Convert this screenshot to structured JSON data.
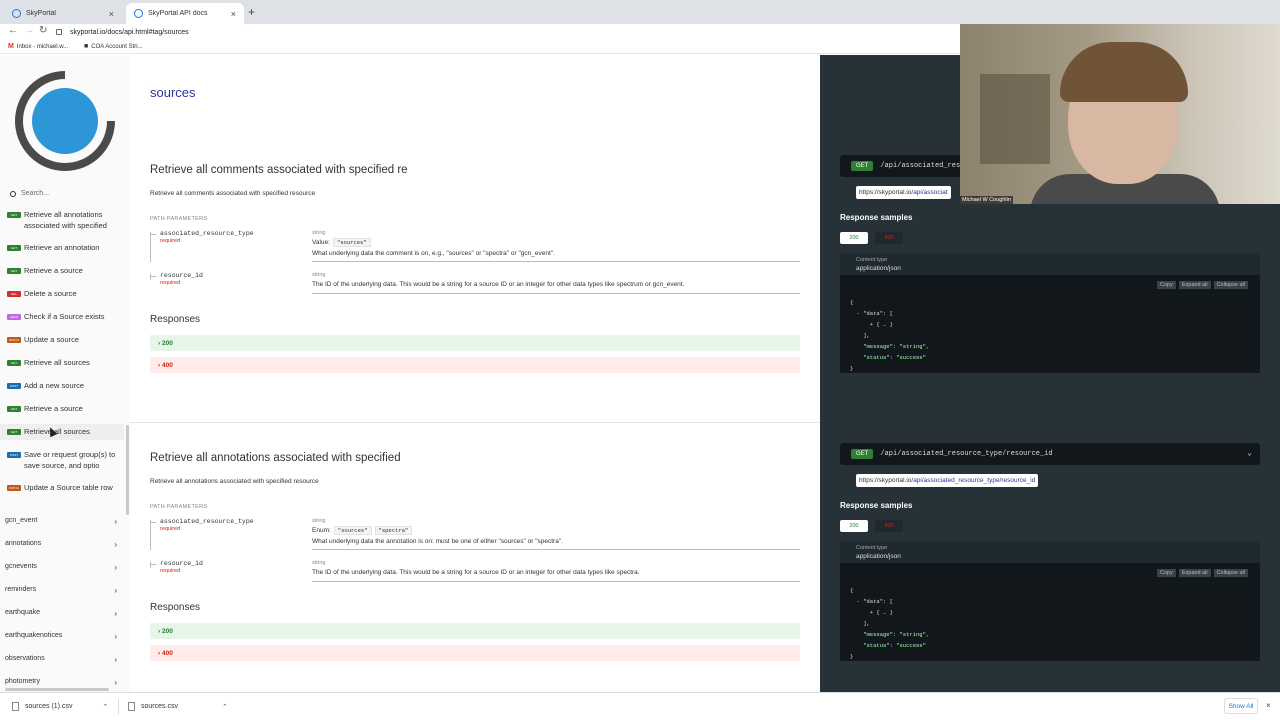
{
  "browser": {
    "tabs": [
      {
        "title": "SkyPortal",
        "close": "×"
      },
      {
        "title": "SkyPortal API docs",
        "close": "×"
      }
    ],
    "new_tab": "+",
    "url": "skyportal.io/docs/api.html#tag/sources",
    "bookmarks": [
      {
        "icon": "M",
        "label": "Inbox - michael.w..."
      },
      {
        "icon": "■",
        "label": "COA Account Stri..."
      }
    ]
  },
  "sidebar": {
    "search_placeholder": "Search...",
    "operations": [
      {
        "method": "GET",
        "label": "Retrieve all annotations associated with specified"
      },
      {
        "method": "GET",
        "label": "Retrieve an annotation"
      },
      {
        "method": "GET",
        "label": "Retrieve a source"
      },
      {
        "method": "DEL",
        "label": "Delete a source"
      },
      {
        "method": "HEAD",
        "label": "Check if a Source exists"
      },
      {
        "method": "PATCH",
        "label": "Update a source"
      },
      {
        "method": "GET",
        "label": "Retrieve all sources"
      },
      {
        "method": "POST",
        "label": "Add a new source"
      },
      {
        "method": "GET",
        "label": "Retrieve a source"
      },
      {
        "method": "GET",
        "label": "Retrieve all sources"
      },
      {
        "method": "POST",
        "label": "Save or request group(s) to save source, and optio"
      },
      {
        "method": "PATCH",
        "label": "Update a Source table row"
      }
    ],
    "categories": [
      "gcn_event",
      "annotations",
      "gcnevents",
      "reminders",
      "earthquake",
      "earthquakenotices",
      "observations",
      "photometry"
    ]
  },
  "main": {
    "section_title": "sources",
    "operations": [
      {
        "title": "Retrieve all comments associated with specified re",
        "description": "Retrieve all comments associated with specified resource",
        "path_params_label": "PATH PARAMETERS",
        "params": [
          {
            "name": "associated_resource_type",
            "required": "required",
            "type": "string",
            "value_label": "Value:",
            "values": [
              "\"sources\""
            ],
            "description": "What underlying data the comment is on, e.g., \"sources\" or \"spectra\" or \"gcn_event\"."
          },
          {
            "name": "resource_id",
            "required": "required",
            "type": "string",
            "value_label": "",
            "values": [],
            "description": "The ID of the underlying data. This would be a string for a source ID or an integer for other data types like spectrum or gcn_event."
          }
        ],
        "responses_title": "Responses",
        "responses": [
          "200",
          "400"
        ]
      },
      {
        "title": "Retrieve all annotations associated with specified",
        "description": "Retrieve all annotations associated with specified resource",
        "path_params_label": "PATH PARAMETERS",
        "params": [
          {
            "name": "associated_resource_type",
            "required": "required",
            "type": "string",
            "value_label": "Enum:",
            "values": [
              "\"sources\"",
              "\"spectra\""
            ],
            "description": "What underlying data the annotation is on: must be one of either \"sources\" or \"spectra\"."
          },
          {
            "name": "resource_id",
            "required": "required",
            "type": "string",
            "value_label": "",
            "values": [],
            "description": "The ID of the underlying data. This would be a string for a source ID or an integer for other data types like spectra."
          }
        ],
        "responses_title": "Responses",
        "responses": [
          "200",
          "400"
        ]
      }
    ]
  },
  "right_panel": {
    "endpoints": [
      {
        "method": "GET",
        "path": "/api/associated_reso",
        "url_host": "https://skyportal.io",
        "url_path": "/api/associat",
        "response_samples": "Response samples",
        "tabs": [
          "200",
          "400"
        ],
        "content_type_label": "Content type",
        "content_type": "application/json",
        "actions": [
          "Copy",
          "Expand all",
          "Collapse all"
        ]
      },
      {
        "method": "GET",
        "path": "/api/associated_resource_type/resource_id",
        "url_host": "https://skyportal.io",
        "url_path": "/api/associated_resource_type/resource_id",
        "response_samples": "Response samples",
        "tabs": [
          "200",
          "400"
        ],
        "content_type_label": "Content type",
        "content_type": "application/json",
        "actions": [
          "Copy",
          "Expand all",
          "Collapse all"
        ]
      }
    ],
    "json_lines": [
      "{",
      "  - \"data\": [",
      "      + { … }",
      "    ],",
      "    \"message\": \"string\",",
      "    \"status\": \"success\"",
      "}"
    ]
  },
  "webcam": {
    "name": "Michael W Coughlin"
  },
  "downloads": {
    "files": [
      "sources (1).csv",
      "sources.csv"
    ],
    "show_all": "Show All",
    "close": "×"
  },
  "colors": {
    "get": "#2f8132",
    "delete": "#cc3333",
    "head": "#c167e4",
    "patch": "#bf581d",
    "post": "#186fad",
    "panel": "#263238",
    "accent": "#32329f"
  }
}
